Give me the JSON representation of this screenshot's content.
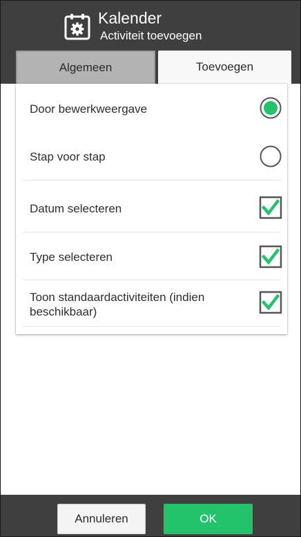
{
  "header": {
    "icon": "calendar-gear-icon",
    "title": "Kalender",
    "subtitle": "Activiteit toevoegen"
  },
  "tabs": [
    {
      "label": "Algemeen",
      "selected": false
    },
    {
      "label": "Toevoegen",
      "selected": true
    }
  ],
  "options": {
    "radios": [
      {
        "label": "Door bewerkweergave",
        "selected": true
      },
      {
        "label": "Stap voor stap",
        "selected": false
      }
    ],
    "checkboxes": [
      {
        "label": "Datum selecteren",
        "checked": true
      },
      {
        "label": "Type selecteren",
        "checked": true
      },
      {
        "label": "Toon standaardactiviteiten (indien beschikbaar)",
        "checked": true
      }
    ]
  },
  "footer": {
    "cancel_label": "Annuleren",
    "ok_label": "OK"
  },
  "colors": {
    "header_bg": "#3f3f3f",
    "accent_green": "#22c36b",
    "tab_inactive": "#b3b3b3"
  }
}
